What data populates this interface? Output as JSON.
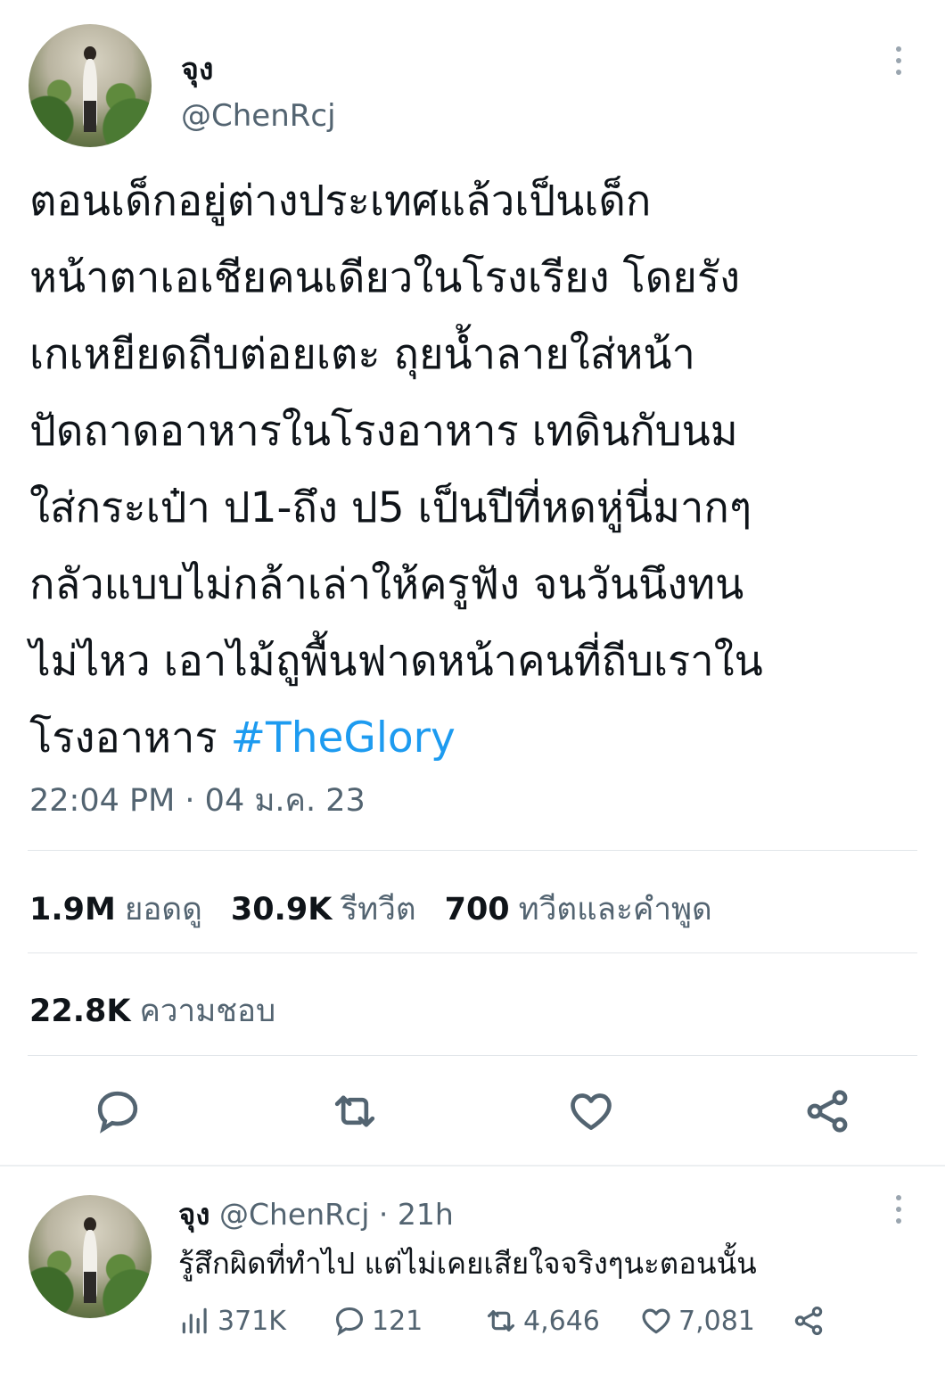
{
  "tweet": {
    "display_name": "จุง",
    "handle": "@ChenRcj",
    "text": "ตอนเด็กอยู่ต่างประเทศแล้วเป็นเด็ก\nหน้าตาเอเชียคนเดียวในโรงเรียง โดยรัง\nเกเหยียดถีบต่อยเตะ ถุยน้ำลายใส่หน้า\nปัดถาดอาหารในโรงอาหาร เทดินกับนม\nใส่กระเป๋า  ป1-ถึง ป5 เป็นปีที่หดหู่นี่มากๆ\nกลัวแบบไม่กล้าเล่าให้ครูฟัง จนวันนึงทน\nไม่ไหว เอาไม้ถูพื้นฟาดหน้าคนที่ถีบเราใน\nโรงอาหาร ",
    "hashtag": "#TheGlory",
    "timestamp": "22:04 PM · 04 ม.ค. 23"
  },
  "stats": {
    "views_value": "1.9M",
    "views_label": "ยอดดู",
    "retweets_value": "30.9K",
    "retweets_label": "รีทวีต",
    "quotes_value": "700",
    "quotes_label": "ทวีตและคำพูด",
    "likes_value": "22.8K",
    "likes_label": "ความชอบ"
  },
  "actions": {
    "reply_icon": "reply-icon",
    "retweet_icon": "retweet-icon",
    "like_icon": "heart-icon",
    "share_icon": "share-icon"
  },
  "reply": {
    "display_name": "จุง",
    "handle": "@ChenRcj",
    "time": "· 21h",
    "text": "รู้สึกผิดที่ทำไป แต่ไม่เคยเสียใจจริงๆนะตอนนั้น",
    "views": "371K",
    "replies": "121",
    "retweets": "4,646",
    "likes": "7,081"
  },
  "colors": {
    "accent": "#1d9bf0",
    "secondary_text": "#536471",
    "icon": "#536471"
  }
}
